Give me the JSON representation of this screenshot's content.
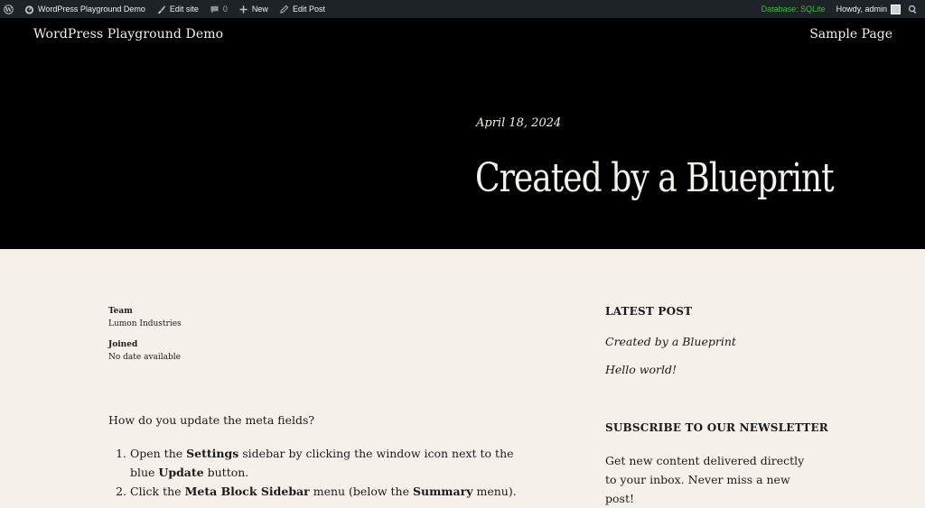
{
  "adminbar": {
    "site_name": "WordPress Playground Demo",
    "edit_site": "Edit site",
    "comments_count": "0",
    "new_label": "New",
    "edit_post": "Edit Post",
    "database": "Database: SQLite",
    "howdy": "Howdy, admin",
    "colors": {
      "background": "#1d2327",
      "database": "#46b450"
    }
  },
  "header": {
    "site_title": "WordPress Playground Demo",
    "nav_item": "Sample Page"
  },
  "post": {
    "date": "April 18, 2024",
    "title": "Created by a Blueprint"
  },
  "meta": {
    "team_label": "Team",
    "team_value": "Lumon Industries",
    "joined_label": "Joined",
    "joined_value": "No date available"
  },
  "content": {
    "question": "How do you update the meta fields?",
    "step1": {
      "a": "Open the ",
      "b": "Settings",
      "c": " sidebar by clicking the window icon next to the blue ",
      "d": "Update",
      "e": " button."
    },
    "step2": {
      "a": "Click the ",
      "b": "Meta Block Sidebar",
      "c": " menu (below the ",
      "d": "Summary",
      "e": " menu)."
    }
  },
  "sidebar": {
    "latest_heading": "LATEST POST",
    "latest_posts": [
      "Created by a Blueprint",
      "Hello world!"
    ],
    "newsletter_heading": "SUBSCRIBE TO OUR NEWSLETTER",
    "newsletter_text": "Get new content delivered directly to your inbox. Never miss a new post!"
  },
  "icons": [
    "wordpress-icon",
    "dashboard-icon",
    "brush-icon",
    "comment-icon",
    "plus-icon",
    "pencil-icon",
    "avatar",
    "search-icon"
  ],
  "colors": {
    "hero_bg": "#000000",
    "page_bg": "#f5f1ea",
    "hero_text": "#f5f1ea"
  }
}
